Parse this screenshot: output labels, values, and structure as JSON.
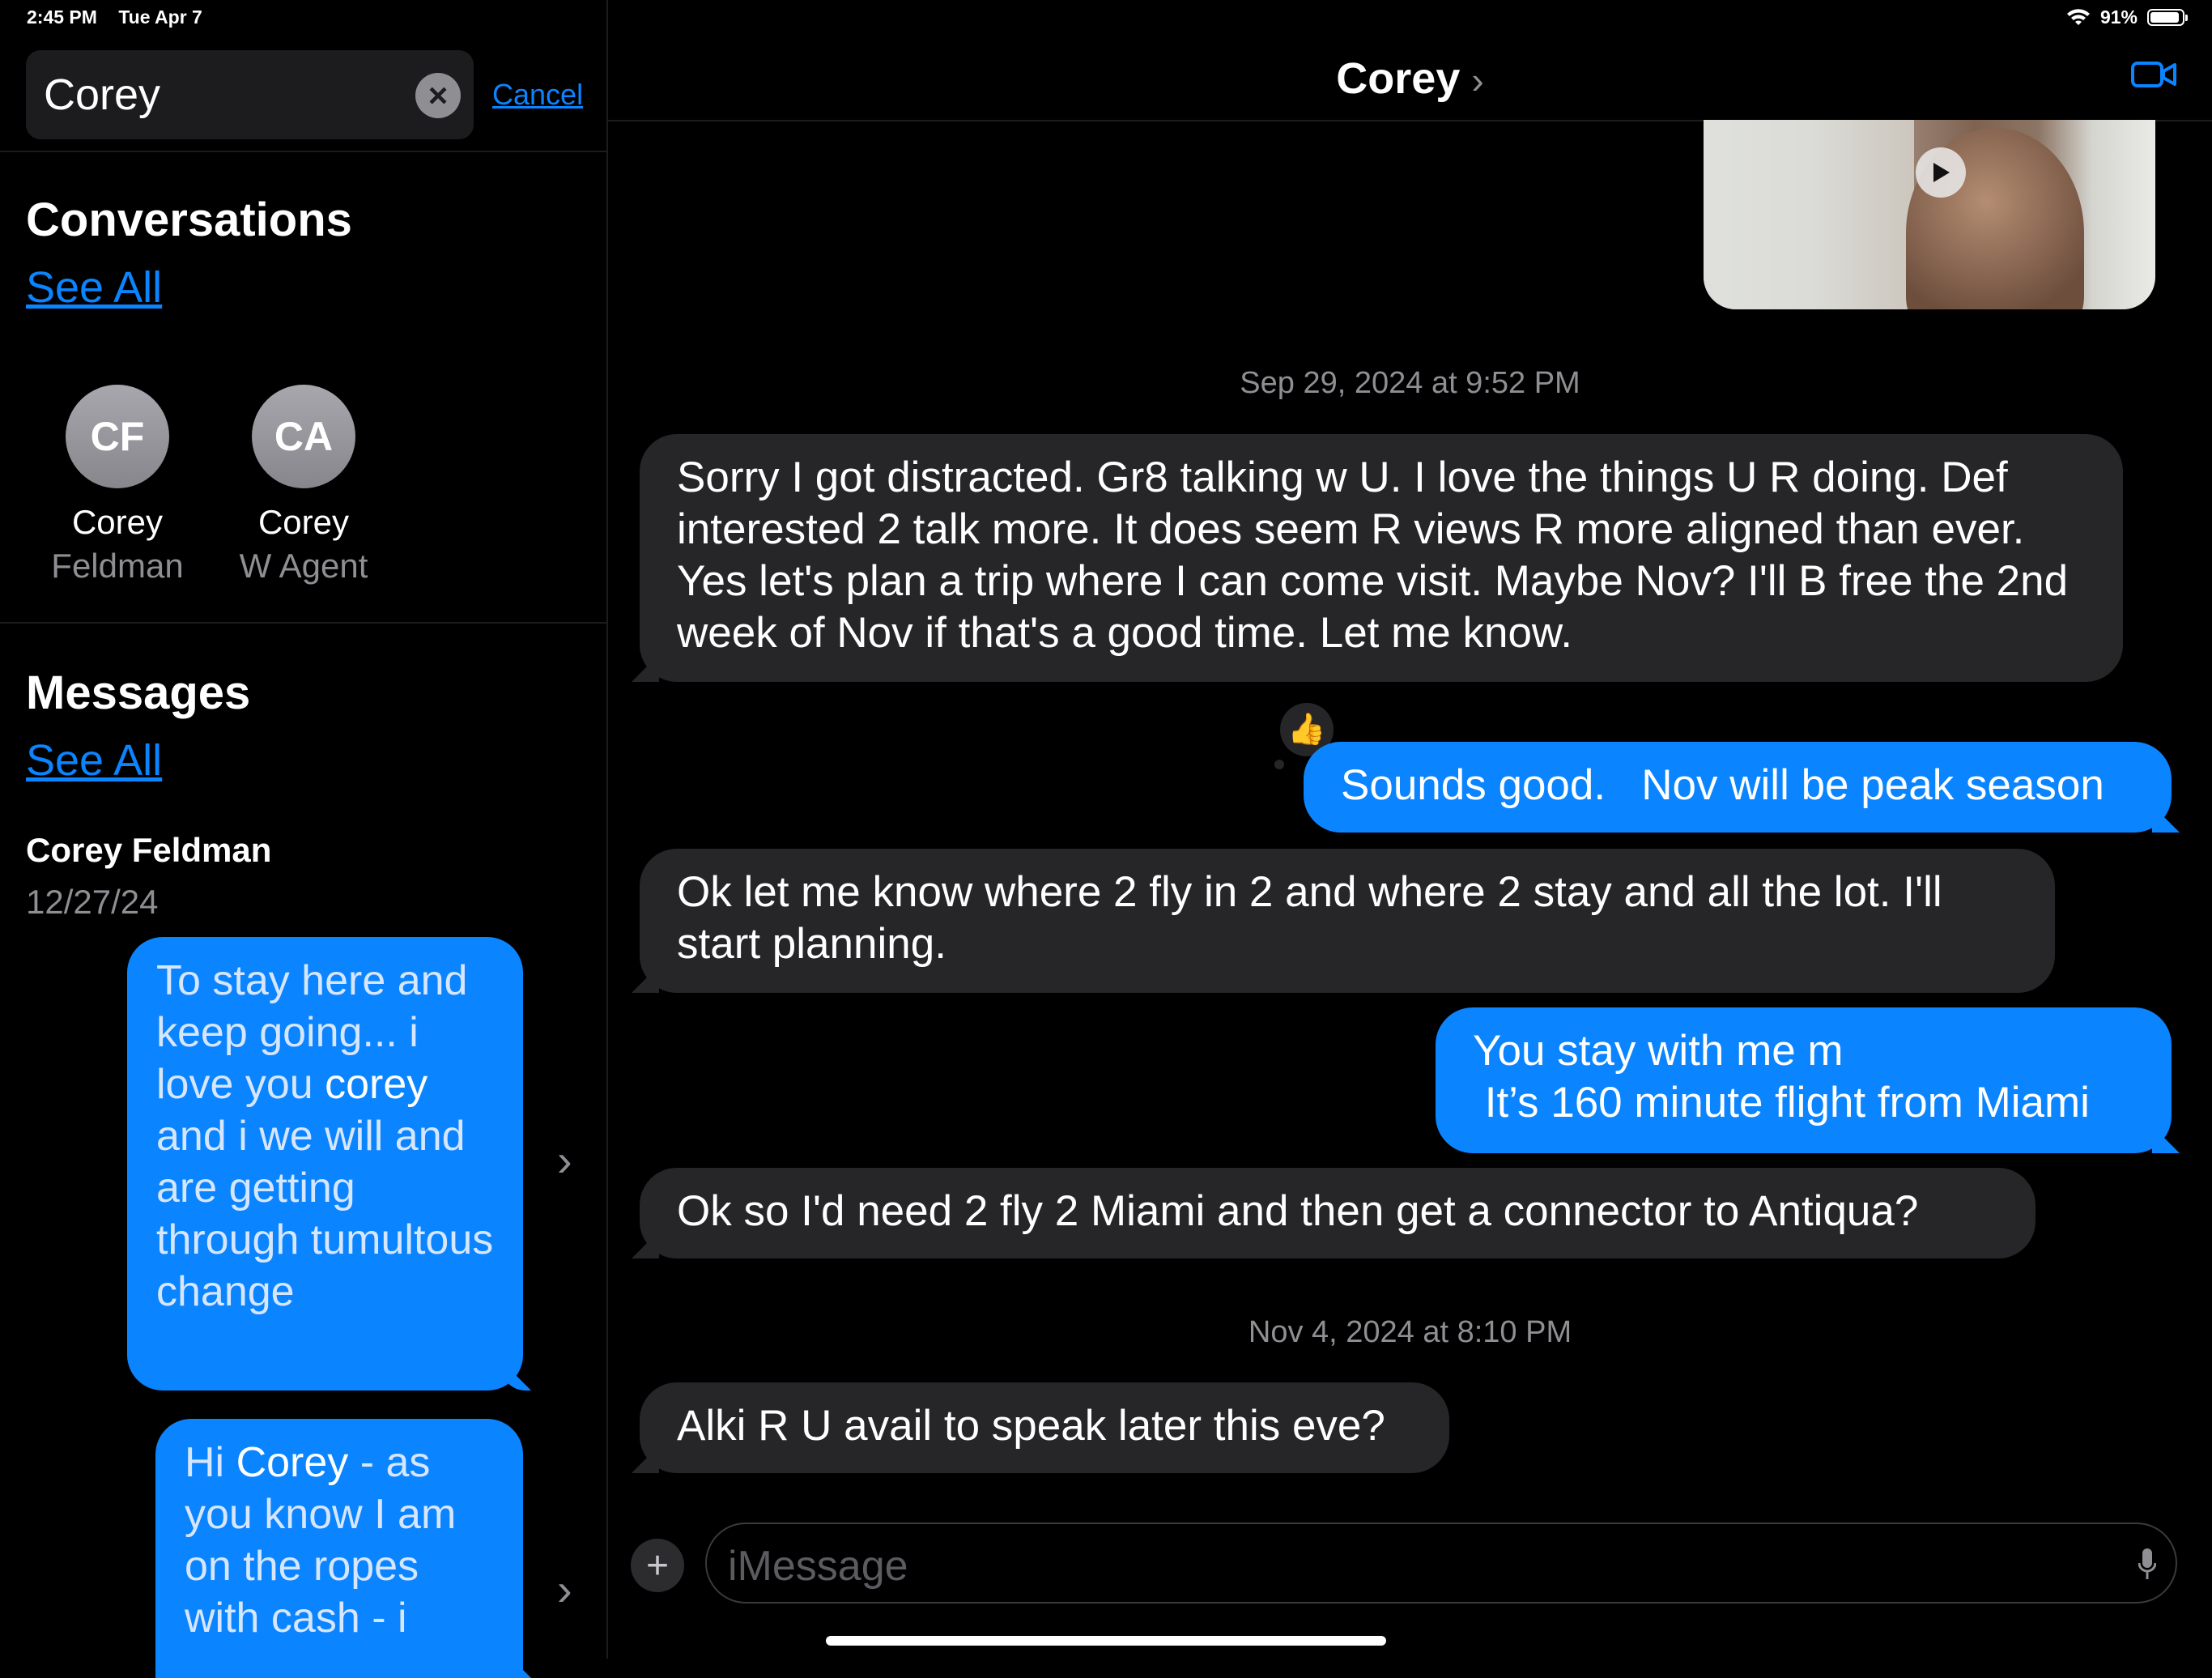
{
  "status_bar": {
    "time": "2:45 PM",
    "date": "Tue Apr 7",
    "battery": "91%",
    "battery_level": 0.91
  },
  "sidebar": {
    "search": {
      "value": "Corey",
      "cancel_label": "Cancel"
    },
    "conversations": {
      "title": "Conversations",
      "see_all": "See All",
      "contacts": [
        {
          "initials": "CF",
          "first": "Corey",
          "second": "Feldman"
        },
        {
          "initials": "CA",
          "first": "Corey",
          "second": "W Agent"
        }
      ]
    },
    "messages": {
      "title": "Messages",
      "see_all": "See All",
      "result": {
        "name": "Corey Feldman",
        "date": "12/27/24",
        "bubble1": {
          "part1": "To stay here and keep going... i love you ",
          "highlight": "corey",
          "part2": " and i we will and are getting through tumultous change"
        },
        "bubble2": {
          "part1": "Hi ",
          "highlight": "Corey",
          "part2": " - as you know I am on the ropes with cash - i"
        }
      }
    }
  },
  "conversation": {
    "title": "Corey",
    "messages": [
      {
        "type": "timestamp",
        "date": "Sep 29, 2024",
        "time": "at 9:52 PM"
      },
      {
        "type": "incoming",
        "text": "Sorry I got distracted. Gr8 talking w U. I love the things U R doing. Def interested 2 talk more. It does seem R views R more aligned than ever. Yes let's plan a trip where I can come visit. Maybe Nov? I'll B free the 2nd week of Nov if that's a good time. Let me know."
      },
      {
        "type": "outgoing",
        "text": "Sounds good.   Nov will be peak season",
        "tapback": "👍"
      },
      {
        "type": "incoming",
        "text": "Ok let me know where 2 fly in 2 and where 2 stay and all the lot. I'll start planning."
      },
      {
        "type": "outgoing",
        "text": "You stay with me m\n It’s 160 minute flight from Miami"
      },
      {
        "type": "incoming",
        "text": "Ok so I'd need 2 fly 2 Miami and then get a connector to Antiqua?"
      },
      {
        "type": "timestamp",
        "date": "Nov 4, 2024",
        "time": "at 8:10 PM"
      },
      {
        "type": "incoming",
        "text": "Alki R U avail to speak later this eve?"
      }
    ],
    "compose_placeholder": "iMessage"
  },
  "icons": [
    "wifi-icon",
    "battery-icon",
    "clear-icon",
    "chevron-right-icon",
    "video-call-icon",
    "play-icon",
    "plus-icon",
    "mic-icon",
    "thumbs-up-icon"
  ],
  "colors": {
    "accent": "#0a84ff",
    "incoming_bubble": "#262628",
    "background": "#000000",
    "secondary_text": "#8e8e93"
  }
}
